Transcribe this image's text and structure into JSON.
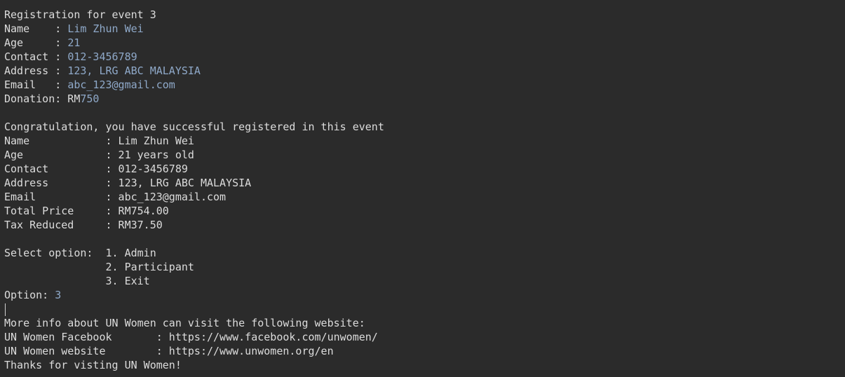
{
  "reg": {
    "header": "Registration for event 3",
    "name_label": "Name    : ",
    "name_value": "Lim Zhun Wei",
    "age_label": "Age     : ",
    "age_value": "21",
    "contact_label": "Contact : ",
    "contact_value": "012-3456789",
    "address_label": "Address : ",
    "address_value": "123, LRG ABC MALAYSIA",
    "email_label": "Email   : ",
    "email_value": "abc_123@gmail.com",
    "donation_label": "Donation: RM",
    "donation_value": "750"
  },
  "summary": {
    "header": "Congratulation, you have successful registered in this event",
    "name": "Name            : Lim Zhun Wei",
    "age": "Age             : 21 years old",
    "contact": "Contact         : 012-3456789",
    "address": "Address         : 123, LRG ABC MALAYSIA",
    "email": "Email           : abc_123@gmail.com",
    "total_price": "Total Price     : RM754.00",
    "tax_reduced": "Tax Reduced     : RM37.50"
  },
  "menu": {
    "prompt_line": "Select option:  1. Admin",
    "option2": "                2. Participant",
    "option3": "                3. Exit",
    "option_label": "Option: ",
    "option_value": "3"
  },
  "info": {
    "intro": "More info about UN Women can visit the following website:",
    "facebook": "UN Women Facebook       : https://www.facebook.com/unwomen/",
    "website": "UN Women website        : https://www.unwomen.org/en",
    "thanks": "Thanks for visting UN Women!"
  }
}
